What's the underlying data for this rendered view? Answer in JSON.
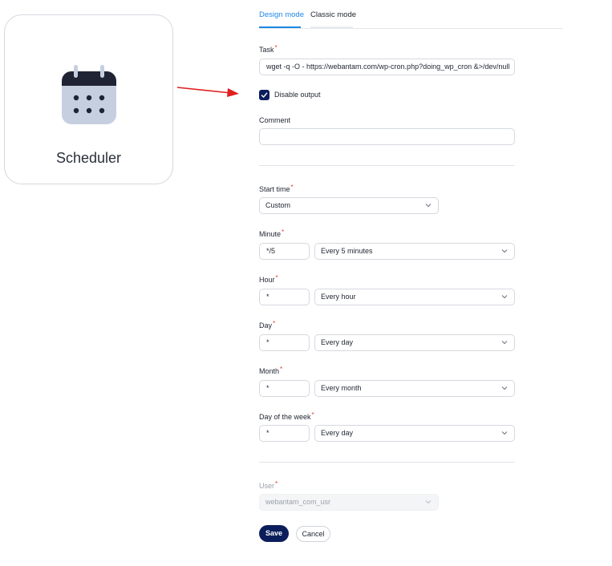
{
  "scheduler_card": {
    "label": "Scheduler",
    "icon": "calendar-icon"
  },
  "tabs": {
    "design": "Design mode",
    "classic": "Classic mode",
    "active": "design"
  },
  "form": {
    "task": {
      "label": "Task",
      "required_mark": "*",
      "value": "wget -q -O - https://webantam.com/wp-cron.php?doing_wp_cron &>/dev/null"
    },
    "disable_output": {
      "label": "Disable output",
      "checked": true
    },
    "comment": {
      "label": "Comment",
      "value": ""
    },
    "start_time": {
      "label": "Start time",
      "required_mark": "*",
      "selected": "Custom"
    },
    "minute": {
      "label": "Minute",
      "required_mark": "*",
      "value": "*/5",
      "selected": "Every 5 minutes"
    },
    "hour": {
      "label": "Hour",
      "required_mark": "*",
      "value": "*",
      "selected": "Every hour"
    },
    "day": {
      "label": "Day",
      "required_mark": "*",
      "value": "*",
      "selected": "Every day"
    },
    "month": {
      "label": "Month",
      "required_mark": "*",
      "value": "*",
      "selected": "Every month"
    },
    "day_of_week": {
      "label": "Day of the week",
      "required_mark": "*",
      "value": "*",
      "selected": "Every day"
    },
    "user": {
      "label": "User",
      "required_mark": "*",
      "selected": "webantam_com_usr"
    }
  },
  "buttons": {
    "save": "Save",
    "cancel": "Cancel"
  },
  "colors": {
    "accent": "#1e88e5",
    "primary_button": "#0b1e5b",
    "required": "#e53935",
    "arrow": "#e02020"
  }
}
